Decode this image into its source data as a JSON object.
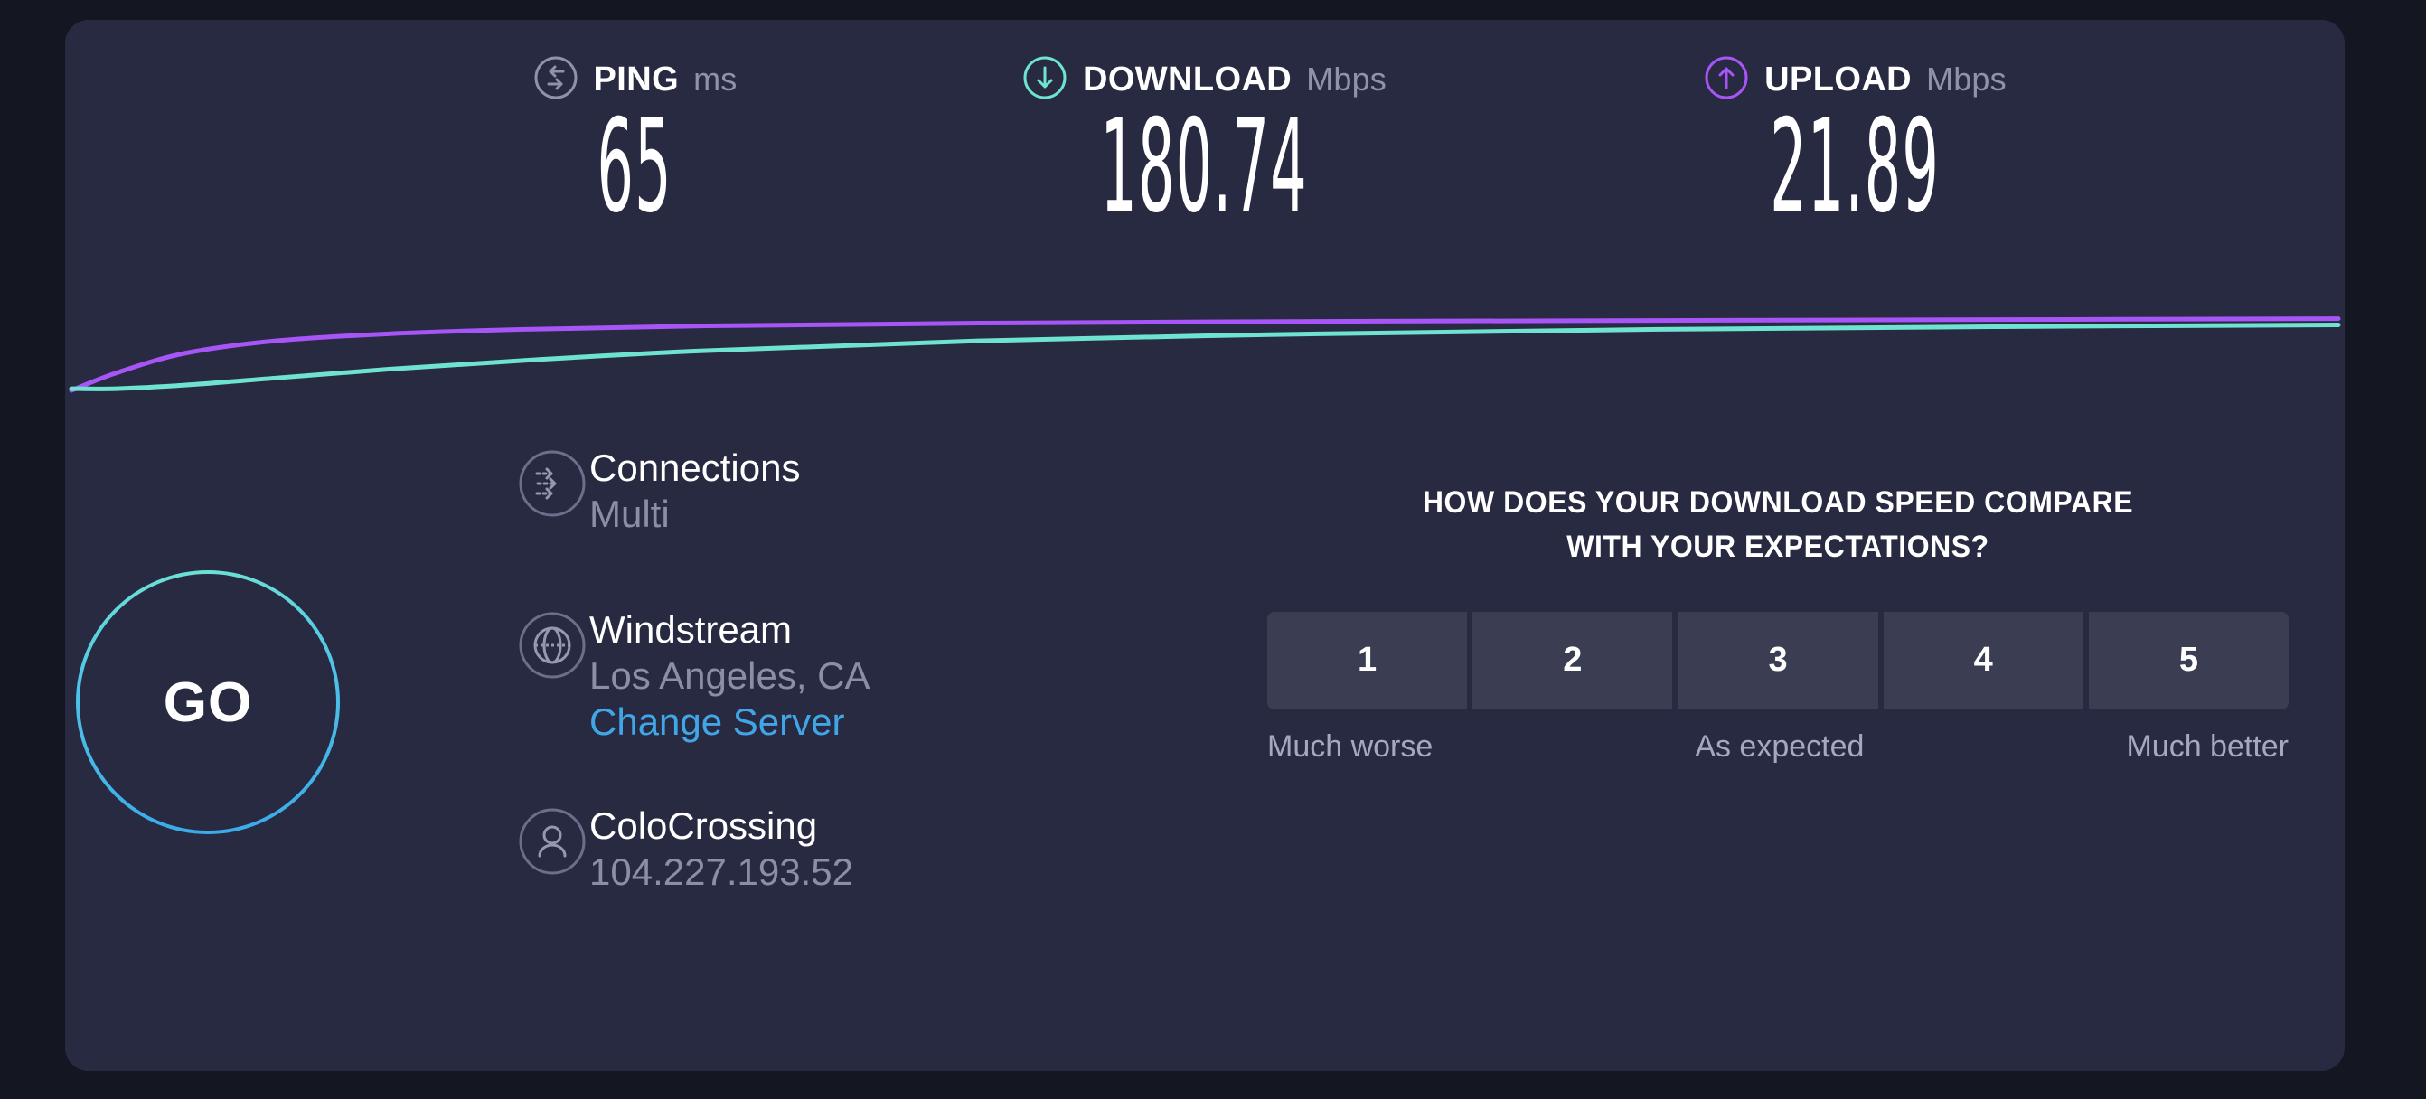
{
  "theme": {
    "page_bg": "#141622",
    "card_bg": "#282a41",
    "ping_color": "#8e92ab",
    "download_color": "#6fe3d2",
    "upload_color": "#a855f7",
    "link_color": "#41a6e8",
    "muted_text": "#8a8ea7",
    "rating_bg": "#3b3d53"
  },
  "results": {
    "ping": {
      "icon": "ping-arrows-icon",
      "title": "PING",
      "unit": "ms",
      "value": "65"
    },
    "download": {
      "icon": "download-arrow-icon",
      "title": "DOWNLOAD",
      "unit": "Mbps",
      "value": "180.74"
    },
    "upload": {
      "icon": "upload-arrow-icon",
      "title": "UPLOAD",
      "unit": "Mbps",
      "value": "21.89"
    }
  },
  "chart_data": {
    "type": "line",
    "title": "",
    "xlabel": "",
    "ylabel": "",
    "grid": false,
    "legend": "none",
    "series": [
      {
        "name": "Upload",
        "color": "#a855f7",
        "x": [
          0,
          2,
          5,
          9,
          14,
          20,
          28,
          40,
          55,
          70,
          85,
          100
        ],
        "y": [
          2,
          22,
          44,
          58,
          66,
          71,
          75,
          78,
          80,
          81,
          82,
          83
        ]
      },
      {
        "name": "Download",
        "color": "#6fe3d2",
        "x": [
          0,
          2,
          5,
          9,
          14,
          20,
          28,
          40,
          55,
          70,
          85,
          100
        ],
        "y": [
          4,
          4,
          8,
          16,
          26,
          36,
          47,
          58,
          66,
          71,
          74,
          76
        ]
      }
    ],
    "xlim": [
      0,
      100
    ],
    "ylim": [
      0,
      100
    ]
  },
  "go_button": {
    "label": "GO"
  },
  "info": {
    "connections": {
      "icon": "connections-arrows-icon",
      "label": "Connections",
      "value": "Multi"
    },
    "server": {
      "icon": "globe-icon",
      "name": "Windstream",
      "location": "Los Angeles, CA",
      "change_link": "Change Server"
    },
    "client": {
      "icon": "person-icon",
      "name": "ColoCrossing",
      "ip": "104.227.193.52"
    }
  },
  "survey": {
    "title_line1": "HOW DOES YOUR DOWNLOAD SPEED COMPARE",
    "title_line2": "WITH YOUR EXPECTATIONS?",
    "ratings": [
      "1",
      "2",
      "3",
      "4",
      "5"
    ],
    "scale_low": "Much worse",
    "scale_mid": "As expected",
    "scale_high": "Much better"
  }
}
